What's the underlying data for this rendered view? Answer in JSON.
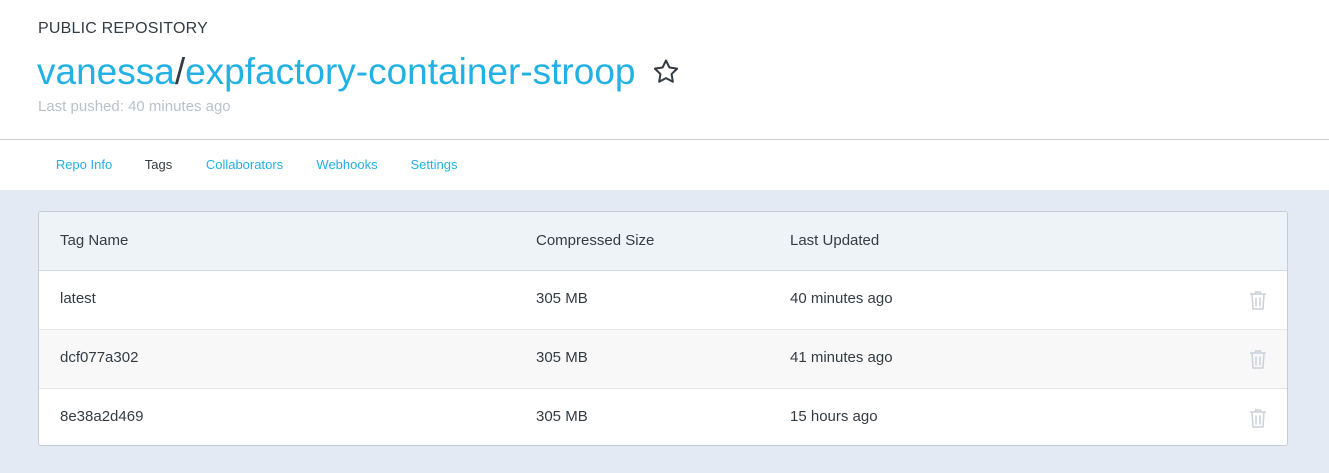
{
  "repo": {
    "visibility": "PUBLIC REPOSITORY",
    "owner": "vanessa",
    "separator": "/",
    "name": "expfactory-container-stroop",
    "last_pushed": "Last pushed: 40 minutes ago"
  },
  "tabs": [
    {
      "label": "Repo Info",
      "active": false
    },
    {
      "label": "Tags",
      "active": true
    },
    {
      "label": "Collaborators",
      "active": false
    },
    {
      "label": "Webhooks",
      "active": false
    },
    {
      "label": "Settings",
      "active": false
    }
  ],
  "table": {
    "headers": [
      "Tag Name",
      "Compressed Size",
      "Last Updated"
    ],
    "rows": [
      {
        "tag": "latest",
        "size": "305 MB",
        "updated": "40 minutes ago"
      },
      {
        "tag": "dcf077a302",
        "size": "305 MB",
        "updated": "41 minutes ago"
      },
      {
        "tag": "8e38a2d469",
        "size": "305 MB",
        "updated": "15 hours ago"
      }
    ]
  },
  "colors": {
    "accent": "#22b1e3",
    "text": "#333c43",
    "muted": "#b9c1c9",
    "content_bg": "#e3eaf3",
    "icon_gray": "#c9d1d9"
  },
  "icons": {
    "star": "star-outline-icon",
    "delete": "trash-icon"
  }
}
